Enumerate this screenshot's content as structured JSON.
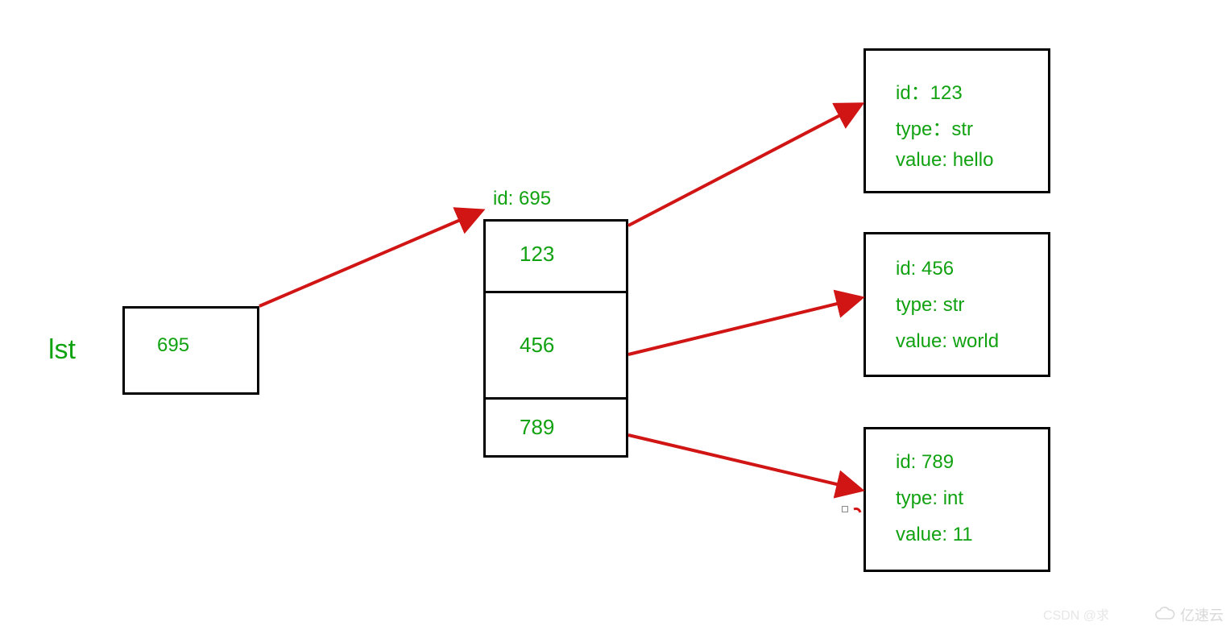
{
  "variable": {
    "name": "lst",
    "ref": "695"
  },
  "list": {
    "id_label": "id:  695",
    "cells": [
      "123",
      "456",
      "789"
    ]
  },
  "objects": [
    {
      "id_line": "id：123",
      "type_line": "type：str",
      "value_line": "value: hello"
    },
    {
      "id_line": "id:  456",
      "type_line": "type: str",
      "value_line": "value: world"
    },
    {
      "id_line": "id: 789",
      "type_line": "type: int",
      "value_line": "value: 11"
    }
  ],
  "watermark": {
    "csdn": "CSDN @求",
    "yisu": "亿速云"
  },
  "chart_data": {
    "type": "diagram",
    "description": "Python list memory/reference diagram",
    "variable": {
      "name": "lst",
      "id": 695
    },
    "list_object": {
      "id": 695,
      "element_ids": [
        123,
        456,
        789
      ]
    },
    "elements": [
      {
        "id": 123,
        "type": "str",
        "value": "hello"
      },
      {
        "id": 456,
        "type": "str",
        "value": "world"
      },
      {
        "id": 789,
        "type": "int",
        "value": 11
      }
    ],
    "arrows": [
      {
        "from": "lst (695)",
        "to": "list id 695"
      },
      {
        "from": "list[0]=123",
        "to": "object id 123"
      },
      {
        "from": "list[1]=456",
        "to": "object id 456"
      },
      {
        "from": "list[2]=789",
        "to": "object id 789"
      }
    ]
  }
}
